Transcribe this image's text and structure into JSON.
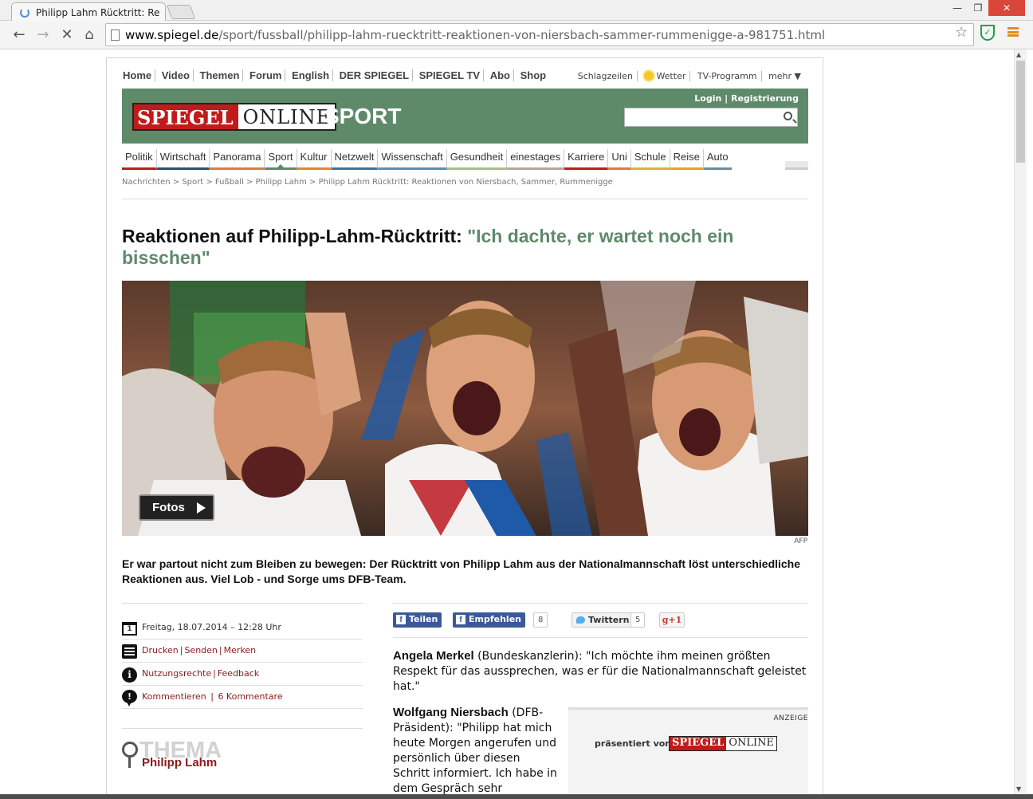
{
  "browser": {
    "tab_title": "Philipp Lahm Rücktritt: Re",
    "url_host": "www.spiegel.de",
    "url_path": "/sport/fussball/philipp-lahm-ruecktritt-reaktionen-von-niersbach-sammer-rummenigge-a-981751.html"
  },
  "topnav": [
    "Home",
    "Video",
    "Themen",
    "Forum",
    "English",
    "DER SPIEGEL",
    "SPIEGEL TV",
    "Abo",
    "Shop"
  ],
  "servicenav": {
    "schlagzeilen": "Schlagzeilen",
    "wetter": "Wetter",
    "tv": "TV-Programm",
    "mehr": "mehr ▼"
  },
  "header": {
    "logo_spiegel": "SPIEGEL",
    "logo_online": "ONLINE",
    "section": "SPORT",
    "login": "Login",
    "register": "Registrierung",
    "brand_color": "#5e8a6a"
  },
  "sections": [
    {
      "label": "Politik",
      "color": "#c01b1b"
    },
    {
      "label": "Wirtschaft",
      "color": "#2f4f6f"
    },
    {
      "label": "Panorama",
      "color": "#e07a3a"
    },
    {
      "label": "Sport",
      "color": "#5e8a6a"
    },
    {
      "label": "Kultur",
      "color": "#e8852f"
    },
    {
      "label": "Netzwelt",
      "color": "#3f6fa0"
    },
    {
      "label": "Wissenschaft",
      "color": "#5b8fb0"
    },
    {
      "label": "Gesundheit",
      "color": "#a5bf8a"
    },
    {
      "label": "einestages",
      "color": "#b3a99a"
    },
    {
      "label": "Karriere",
      "color": "#c01b1b"
    },
    {
      "label": "Uni",
      "color": "#e07a3a"
    },
    {
      "label": "Schule",
      "color": "#e0b030"
    },
    {
      "label": "Reise",
      "color": "#e8a020"
    },
    {
      "label": "Auto",
      "color": "#6a8aa8"
    }
  ],
  "breadcrumb": "Nachrichten > Sport > Fußball > Philipp Lahm > Philipp Lahm Rücktritt: Reaktionen von Niersbach, Sammer, Rummenigge",
  "article": {
    "headline_main": "Reaktionen auf Philipp-Lahm-Rücktritt:",
    "headline_quote": "\"Ich dachte, er wartet noch ein bisschen\"",
    "fotos_label": "Fotos",
    "credit": "AFP",
    "teaser": "Er war partout nicht zum Bleiben zu bewegen: Der Rücktritt von Philipp Lahm aus der Nationalmannschaft löst unterschiedliche Reaktionen aus. Viel Lob - und Sorge ums DFB-Team.",
    "date": "Freitag, 18.07.2014 – 12:28 Uhr",
    "calendar_day": "1",
    "drucken": "Drucken",
    "senden": "Senden",
    "merken": "Merken",
    "nutzungsrechte": "Nutzungsrechte",
    "feedback": "Feedback",
    "kommentieren": "Kommentieren",
    "kommentare": "6 Kommentare",
    "thema_word": "THEMA",
    "thema_link": "Philipp Lahm",
    "p1_name": "Angela Merkel",
    "p1_text": " (Bundeskanzlerin): \"Ich möchte ihm meinen größten Respekt für das aussprechen, was er für die Nationalmannschaft geleistet hat.\"",
    "p2_name": "Wolfgang Niersbach",
    "p2_text": " (DFB-Präsident): \"Philipp hat mich heute Morgen angerufen und persönlich über diesen Schritt informiert. Ich habe in dem Gespräch sehr"
  },
  "share": {
    "teilen": "Teilen",
    "empfehlen": "Empfehlen",
    "empfehlen_count": "8",
    "twittern": "Twittern",
    "twitter_count": "5",
    "gplus": "g+1"
  },
  "ad": {
    "label": "ANZEIGE",
    "presents": "präsentiert von",
    "logo_spiegel": "SPIEGEL",
    "logo_online": "ONLINE"
  }
}
